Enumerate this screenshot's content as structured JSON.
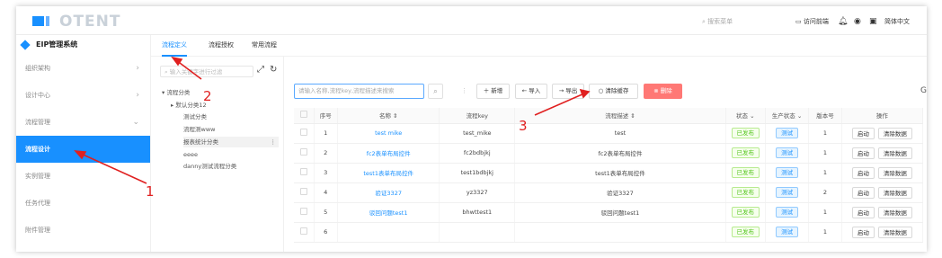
{
  "header": {
    "brand": "OTENT",
    "search_placeholder": "搜索菜单",
    "visit_home": "访问前端",
    "language": "简体中文"
  },
  "sidebar": {
    "system_title": "EIP管理系统",
    "items": [
      {
        "label": "组织架构",
        "chevron": "›"
      },
      {
        "label": "设计中心",
        "chevron": "›"
      },
      {
        "label": "流程管理",
        "chevron": "⌄"
      },
      {
        "label": "流程设计",
        "chevron": ""
      },
      {
        "label": "实例管理",
        "chevron": ""
      },
      {
        "label": "任务代理",
        "chevron": ""
      },
      {
        "label": "附件管理",
        "chevron": ""
      }
    ]
  },
  "tabs": [
    "流程定义",
    "流程授权",
    "常用流程"
  ],
  "tree": {
    "search_placeholder": "输入关键字进行过滤",
    "nodes": [
      "流程分类",
      "默认分类12",
      "测试分类",
      "流程测www",
      "报表统计分类",
      "eeee",
      "danny测试流程分类"
    ]
  },
  "toolbar": {
    "search_placeholder": "请输入名称,流程key,流程描述来搜索",
    "separator": "⋮",
    "add": "新增",
    "import": "导入",
    "export": "导出",
    "clear_cache": "清除缓存",
    "delete": "删除"
  },
  "table": {
    "headers": [
      "序号",
      "名称 ⇕",
      "流程key",
      "流程描述 ⇕",
      "状态 ⌄",
      "生产状态 ⌄",
      "版本号",
      "操作"
    ],
    "rows": [
      {
        "no": "1",
        "name": "test mike",
        "key": "test_mike",
        "desc": "test",
        "status": "已发布",
        "prod": "测试",
        "ver": "1",
        "op1": "启动",
        "op2": "清除数据"
      },
      {
        "no": "2",
        "name": "fc2表单布局控件",
        "key": "fc2bdbjkj",
        "desc": "fc2表单布局控件",
        "status": "已发布",
        "prod": "测试",
        "ver": "1",
        "op1": "启动",
        "op2": "清除数据"
      },
      {
        "no": "3",
        "name": "test1表单布局控件",
        "key": "test1bdbjkj",
        "desc": "test1表单布局控件",
        "status": "已发布",
        "prod": "测试",
        "ver": "1",
        "op1": "启动",
        "op2": "清除数据"
      },
      {
        "no": "4",
        "name": "验证3327",
        "key": "yz3327",
        "desc": "验证3327",
        "status": "已发布",
        "prod": "测试",
        "ver": "2",
        "op1": "启动",
        "op2": "清除数据"
      },
      {
        "no": "5",
        "name": "驳回问题test1",
        "key": "bhwttest1",
        "desc": "驳回问题test1",
        "status": "已发布",
        "prod": "测试",
        "ver": "1",
        "op1": "启动",
        "op2": "清除数据"
      },
      {
        "no": "6",
        "name": "",
        "key": "",
        "desc": "",
        "status": "已发布",
        "prod": "测试",
        "ver": "1",
        "op1": "启动",
        "op2": "清除数据"
      }
    ]
  },
  "annotations": [
    "1",
    "2",
    "3"
  ],
  "colors": {
    "accent": "#1890ff",
    "danger": "#ff7875",
    "annotation": "#e02020"
  }
}
